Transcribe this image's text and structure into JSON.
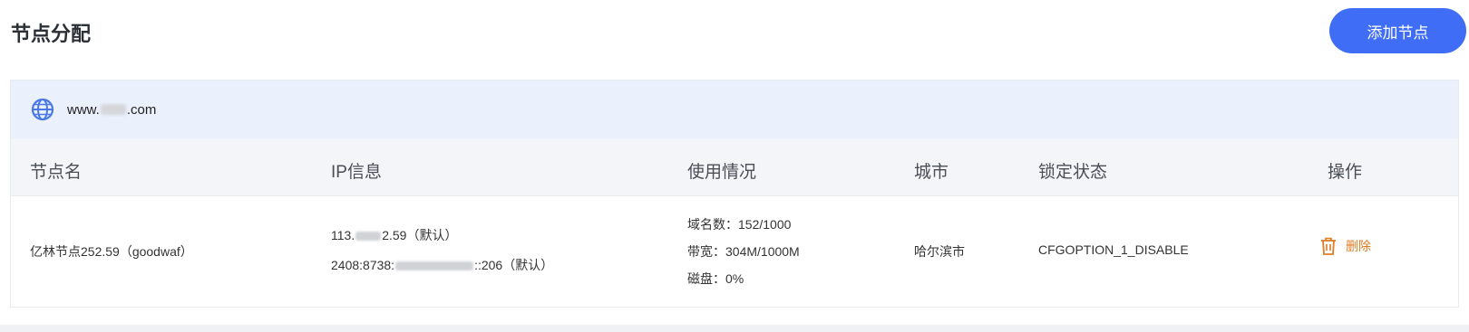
{
  "header": {
    "title": "节点分配",
    "add_button": "添加节点"
  },
  "domain": {
    "prefix": "www.",
    "suffix": ".com",
    "icon": "globe-icon"
  },
  "table": {
    "columns": [
      "节点名",
      "IP信息",
      "使用情况",
      "城市",
      "锁定状态",
      "操作"
    ],
    "rows": [
      {
        "name": "亿林节点252.59（goodwaf）",
        "ip1_prefix": "113.",
        "ip1_suffix": "2.59（默认）",
        "ip2_prefix": "2408:8738:",
        "ip2_suffix": "::206（默认）",
        "usage_domains": "域名数：152/1000",
        "usage_bandwidth": "带宽：304M/1000M",
        "usage_disk": "磁盘：0%",
        "city": "哈尔滨市",
        "lock_status": "CFGOPTION_1_DISABLE",
        "action": "删除"
      }
    ]
  },
  "colors": {
    "accent": "#3f6df6",
    "delete": "#e07b22"
  }
}
